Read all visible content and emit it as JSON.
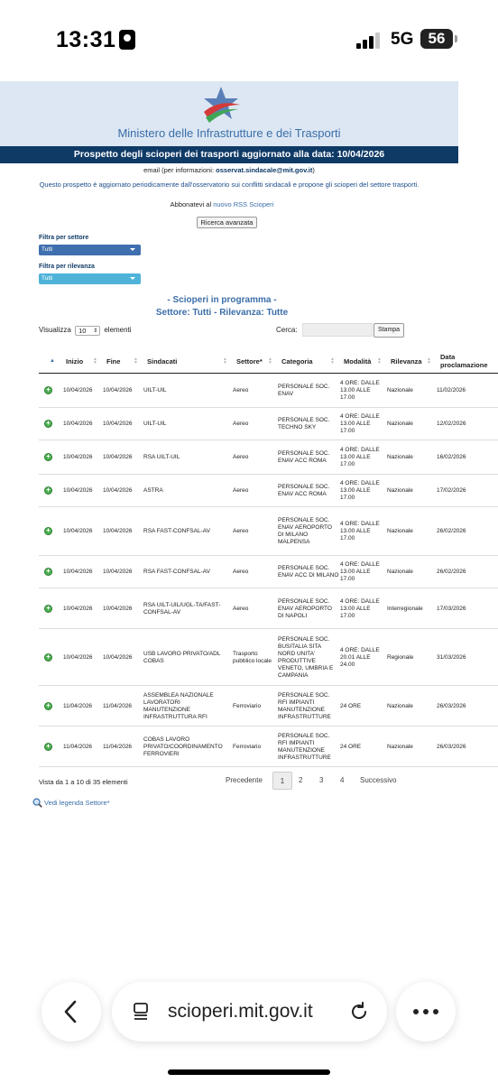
{
  "statusbar": {
    "time": "13:31",
    "network": "5G",
    "battery": "56"
  },
  "header": {
    "ministry": "Ministero delle Infrastrutture e dei Trasporti",
    "banner": "Prospetto degli scioperi dei trasporti aggiornato alla data: 10/04/2026",
    "email_prefix": "email (per informazioni:",
    "email": "osservat.sindacale@mit.gov.it",
    "email_suffix": ")",
    "description": "Questo prospetto è aggiornato periodicamente dall'osservatorio sui conflitti sindacali e propone gli scioperi del settore trasporti.",
    "rss_prefix": "Abbonatevi al",
    "rss_link": "nuovo RSS Scioperi",
    "advanced_search": "Ricerca avanzata"
  },
  "filters": {
    "sector_label": "Filtra per settore",
    "sector_value": "Tutti",
    "relevance_label": "Filtra per rilevanza",
    "relevance_value": "Tutti"
  },
  "program": {
    "title": "- Scioperi in programma -",
    "subtitle": "Settore: Tutti - Rilevanza: Tutte"
  },
  "controls": {
    "show_label": "Visualizza",
    "show_value": "10",
    "show_suffix": "elementi",
    "search_label": "Cerca:",
    "search_value": "",
    "print_label": "Stampa"
  },
  "table": {
    "columns": [
      "Inizio",
      "Fine",
      "Sindacati",
      "Settore*",
      "Categoria",
      "Modalità",
      "Rilevanza",
      "Data proclamazione"
    ],
    "rows": [
      {
        "inizio": "10/04/2026",
        "fine": "10/04/2026",
        "sindacati": "UILT-UIL",
        "settore": "Aereo",
        "categoria": "PERSONALE SOC. ENAV",
        "modalita": "4 ORE: DALLE 13.00 ALLE 17.00",
        "rilevanza": "Nazionale",
        "data": "11/02/2026"
      },
      {
        "inizio": "10/04/2026",
        "fine": "10/04/2026",
        "sindacati": "UILT-UIL",
        "settore": "Aereo",
        "categoria": "PERSONALE SOC. TECHNO SKY",
        "modalita": "4 ORE: DALLE 13.00 ALLE 17.00",
        "rilevanza": "Nazionale",
        "data": "12/02/2026"
      },
      {
        "inizio": "10/04/2026",
        "fine": "10/04/2026",
        "sindacati": "RSA UILT-UIL",
        "settore": "Aereo",
        "categoria": "PERSONALE SOC. ENAV ACC ROMA",
        "modalita": "4 ORE: DALLE 13.00 ALLE 17.00",
        "rilevanza": "Nazionale",
        "data": "16/02/2026"
      },
      {
        "inizio": "10/04/2026",
        "fine": "10/04/2026",
        "sindacati": "ASTRA",
        "settore": "Aereo",
        "categoria": "PERSONALE SOC. ENAV ACC ROMA",
        "modalita": "4 ORE: DALLE 13.00 ALLE 17.00",
        "rilevanza": "Nazionale",
        "data": "17/02/2026"
      },
      {
        "inizio": "10/04/2026",
        "fine": "10/04/2026",
        "sindacati": "RSA FAST-CONFSAL-AV",
        "settore": "Aereo",
        "categoria": "PERSONALE SOC. ENAV AEROPORTO DI MILANO MALPENSA",
        "modalita": "4 ORE: DALLE 13.00 ALLE 17.00",
        "rilevanza": "Nazionale",
        "data": "26/02/2026"
      },
      {
        "inizio": "10/04/2026",
        "fine": "10/04/2026",
        "sindacati": "RSA FAST-CONFSAL-AV",
        "settore": "Aereo",
        "categoria": "PERSONALE SOC. ENAV ACC DI MILANO",
        "modalita": "4 ORE: DALLE 13.00 ALLE 17.00",
        "rilevanza": "Nazionale",
        "data": "26/02/2026"
      },
      {
        "inizio": "10/04/2026",
        "fine": "10/04/2026",
        "sindacati": "RSA UILT-UIL/UGL-TA/FAST-CONFSAL-AV",
        "settore": "Aereo",
        "categoria": "PERSONALE SOC. ENAV AEROPORTO DI NAPOLI",
        "modalita": "4 ORE: DALLE 13.00 ALLE 17.00",
        "rilevanza": "Interregionale",
        "data": "17/03/2026"
      },
      {
        "inizio": "10/04/2026",
        "fine": "10/04/2026",
        "sindacati": "USB LAVORO PRIVATO/ADL COBAS",
        "settore": "Trasporto pubblico locale",
        "categoria": "PERSONALE SOC. BUSITALIA SITA NORD UNITA' PRODUTTIVE VENETO, UMBRIA E CAMPANIA",
        "modalita": "4 ORE: DALLE 20.01 ALLE 24.00",
        "rilevanza": "Regionale",
        "data": "31/03/2026"
      },
      {
        "inizio": "11/04/2026",
        "fine": "11/04/2026",
        "sindacati": "ASSEMBLEA NAZIONALE LAVORATORI MANUTENZIONE INFRASTRUTTURA RFI",
        "settore": "Ferroviario",
        "categoria": "PERSONALE SOC. RFI IMPIANTI MANUTENZIONE INFRASTRUTTURE",
        "modalita": "24 ORE",
        "rilevanza": "Nazionale",
        "data": "26/03/2026"
      },
      {
        "inizio": "11/04/2026",
        "fine": "11/04/2026",
        "sindacati": "COBAS LAVORO PRIVATO/COORDINAMENTO FERROVIERI",
        "settore": "Ferroviario",
        "categoria": "PERSONALE SOC. RFI IMPIANTI MANUTENZIONE INFRASTRUTTURE",
        "modalita": "24 ORE",
        "rilevanza": "Nazionale",
        "data": "26/03/2026"
      }
    ]
  },
  "footer": {
    "info": "Vista da 1 a 10 di 35 elementi",
    "prev": "Precedente",
    "pages": [
      "1",
      "2",
      "3",
      "4"
    ],
    "next": "Successivo",
    "legend": "Vedi legenda Settore*"
  },
  "browser": {
    "url": "scioperi.mit.gov.it"
  },
  "colors": {
    "banner": "#0f3a66",
    "header_bg": "#dce7f3",
    "link": "#3b6ea8",
    "sector_select": "#3f6fae",
    "relevance_select": "#4fb3d9",
    "plus_icon": "#4caf50"
  },
  "icons": {
    "back": "chevron-left-icon",
    "tabs": "tabs-icon",
    "reload": "reload-icon",
    "more": "more-icon",
    "expand": "plus-circle-icon",
    "legend": "magnifier-icon"
  }
}
